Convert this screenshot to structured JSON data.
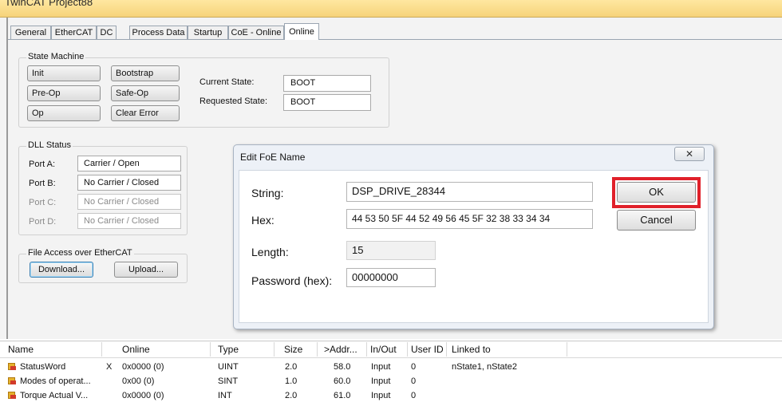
{
  "window": {
    "title": "TwinCAT Project88"
  },
  "tabs": [
    "General",
    "EtherCAT",
    "DC",
    "Process Data",
    "Startup",
    "CoE - Online",
    "Online"
  ],
  "active_tab": "Online",
  "state_machine": {
    "title": "State Machine",
    "buttons": {
      "init": "Init",
      "bootstrap": "Bootstrap",
      "preop": "Pre-Op",
      "safeop": "Safe-Op",
      "op": "Op",
      "clear_error": "Clear Error"
    },
    "current_state_label": "Current State:",
    "current_state_value": "BOOT",
    "requested_state_label": "Requested State:",
    "requested_state_value": "BOOT"
  },
  "dll_status": {
    "title": "DLL Status",
    "ports": [
      {
        "label": "Port A:",
        "value": "Carrier / Open"
      },
      {
        "label": "Port B:",
        "value": "No Carrier / Closed"
      },
      {
        "label": "Port C:",
        "value": "No Carrier / Closed"
      },
      {
        "label": "Port D:",
        "value": "No Carrier / Closed"
      }
    ]
  },
  "file_access": {
    "title": "File Access over EtherCAT",
    "download": "Download...",
    "upload": "Upload..."
  },
  "dialog": {
    "title": "Edit FoE Name",
    "close_glyph": "✕",
    "string_label": "String:",
    "string_value": "DSP_DRIVE_28344",
    "hex_label": "Hex:",
    "hex_value": "44 53 50 5F 44 52 49 56 45 5F 32 38 33 34 34",
    "length_label": "Length:",
    "length_value": "15",
    "password_label": "Password (hex):",
    "password_value": "00000000",
    "ok": "OK",
    "cancel": "Cancel",
    "highlight_color": "#e0202a"
  },
  "table": {
    "headers": [
      "Name",
      "Online",
      "Type",
      "Size",
      ">Addr...",
      "In/Out",
      "User ID",
      "Linked to"
    ],
    "rows": [
      {
        "name": "StatusWord",
        "x": "X",
        "online": "0x0000 (0)",
        "type": "UINT",
        "size": "2.0",
        "addr": "58.0",
        "inout": "Input",
        "userid": "0",
        "linked": "nState1, nState2"
      },
      {
        "name": "Modes of operat...",
        "x": "",
        "online": "0x00 (0)",
        "type": "SINT",
        "size": "1.0",
        "addr": "60.0",
        "inout": "Input",
        "userid": "0",
        "linked": ""
      },
      {
        "name": "Torque Actual V...",
        "x": "",
        "online": "0x0000 (0)",
        "type": "INT",
        "size": "2.0",
        "addr": "61.0",
        "inout": "Input",
        "userid": "0",
        "linked": ""
      }
    ]
  }
}
